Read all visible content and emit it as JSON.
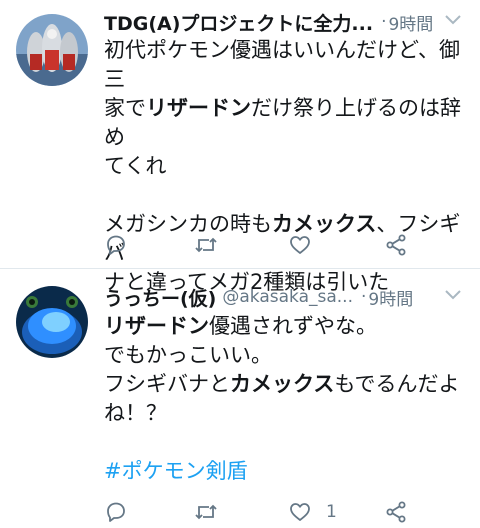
{
  "tweets": [
    {
      "name": "TDG(A)プロジェクトに全力...",
      "handle": "",
      "dot": "·",
      "time": "9時間",
      "lines": [
        [
          {
            "t": "初代ポケモン優遇はいいんだけど、御三"
          }
        ],
        [
          {
            "t": "家で"
          },
          {
            "t": "リザードン",
            "b": true
          },
          {
            "t": "だけ祭り上げるのは辞め"
          }
        ],
        [
          {
            "t": "てくれ"
          }
        ],
        [],
        [
          {
            "t": "メガシンカの時も"
          },
          {
            "t": "カメックス",
            "b": true
          },
          {
            "t": "、フシギバ"
          }
        ],
        [
          {
            "t": "ナと違ってメガ2種類は引いた"
          }
        ]
      ],
      "reply_count": "",
      "retweet_count": "",
      "like_count": "",
      "avatar_colors": {
        "bg": "#7fa3c9",
        "accent": "#c9342c",
        "silver": "#cfd3d8"
      }
    },
    {
      "name": "うっちー(仮)",
      "handle": "@akasaka_sa...",
      "dot": "·",
      "time": "9時間",
      "lines": [
        [
          {
            "t": "リザードン",
            "b": true
          },
          {
            "t": "優遇されずやな。"
          }
        ],
        [
          {
            "t": "でもかっこいい。"
          }
        ],
        [
          {
            "t": "フシギバナと"
          },
          {
            "t": "カメックス",
            "b": true
          },
          {
            "t": "もでるんだよ"
          }
        ],
        [
          {
            "t": "ね！？"
          }
        ],
        [],
        [
          {
            "t": "#ポケモン剣盾",
            "h": true
          }
        ]
      ],
      "reply_count": "",
      "retweet_count": "",
      "like_count": "1",
      "avatar_colors": {
        "bg": "#0a2a4a",
        "accent": "#2f8fff",
        "glow": "#7fd0ff"
      }
    }
  ],
  "colors": {
    "text": "#14171a",
    "meta": "#657786",
    "link": "#1da1f2",
    "divider": "#e1e8ed"
  },
  "icons": [
    "reply-icon",
    "retweet-icon",
    "like-icon",
    "share-icon",
    "chevron-down-icon"
  ]
}
